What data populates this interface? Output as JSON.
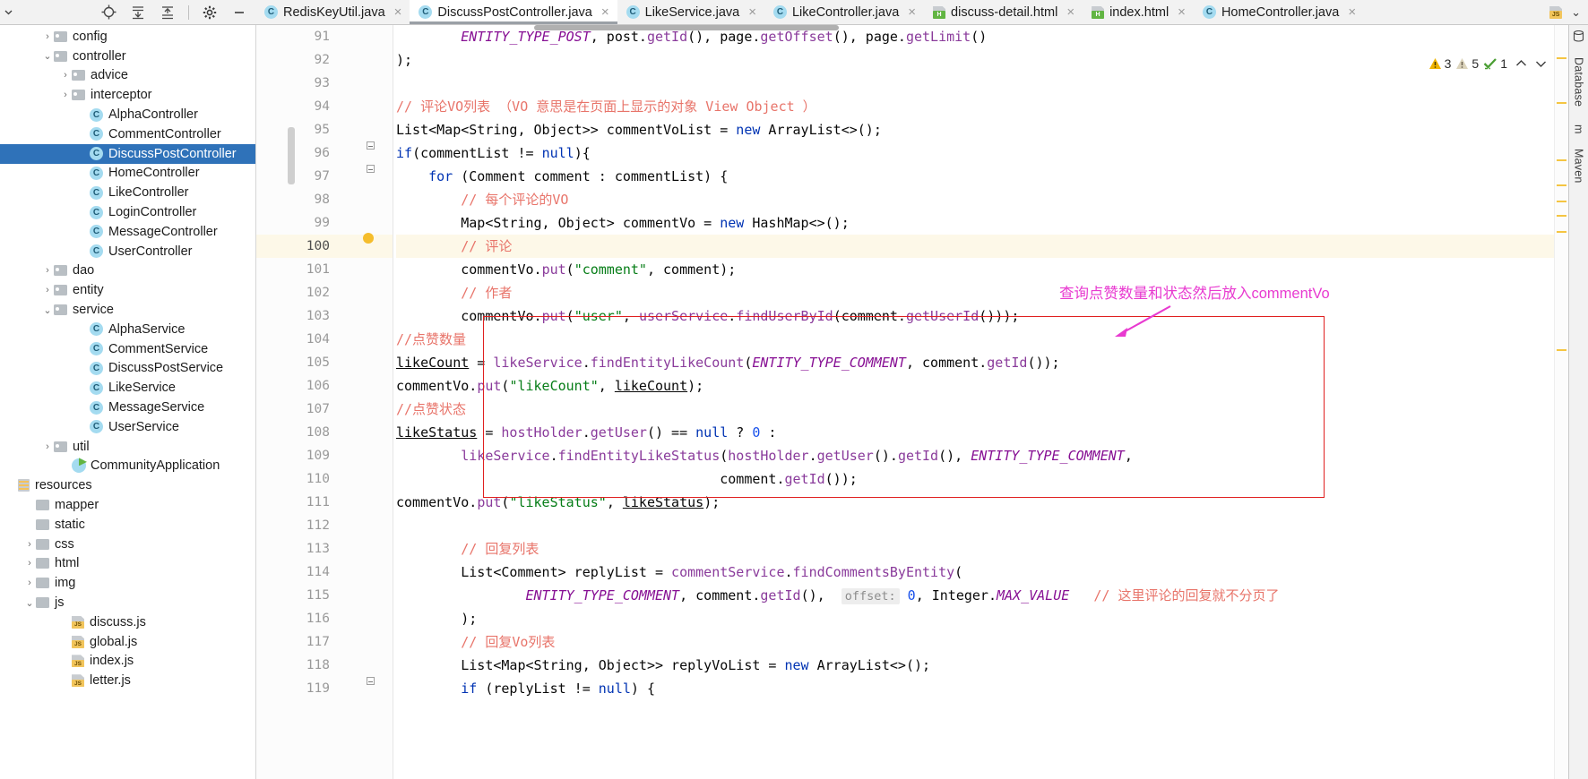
{
  "toolbar": {
    "icons": [
      {
        "name": "locate-icon",
        "glyph": "target"
      },
      {
        "name": "expand-all-icon",
        "glyph": "expand"
      },
      {
        "name": "collapse-all-icon",
        "glyph": "collapse"
      },
      {
        "name": "settings-gear-icon",
        "glyph": "gear"
      },
      {
        "name": "hide-icon",
        "glyph": "minus"
      }
    ]
  },
  "tabs": [
    {
      "label": "RedisKeyUtil.java",
      "type": "java",
      "active": false,
      "close": "×"
    },
    {
      "label": "DiscussPostController.java",
      "type": "java",
      "active": true,
      "close": "×"
    },
    {
      "label": "LikeService.java",
      "type": "java",
      "active": false,
      "close": "×"
    },
    {
      "label": "LikeController.java",
      "type": "java",
      "active": false,
      "close": "×"
    },
    {
      "label": "discuss-detail.html",
      "type": "html",
      "active": false,
      "close": "×"
    },
    {
      "label": "index.html",
      "type": "html",
      "active": false,
      "close": "×"
    },
    {
      "label": "HomeController.java",
      "type": "java",
      "active": false,
      "close": "×"
    }
  ],
  "tabs_overflow": {
    "icon": "js-file-icon",
    "chevron": "⌄"
  },
  "tree": [
    {
      "label": "config",
      "type": "folder",
      "arrow": "›",
      "indent": 2,
      "selected": false
    },
    {
      "label": "controller",
      "type": "folder",
      "arrow": "⌄",
      "indent": 2,
      "selected": false
    },
    {
      "label": "advice",
      "type": "folder",
      "arrow": "›",
      "indent": 3,
      "selected": false
    },
    {
      "label": "interceptor",
      "type": "folder",
      "arrow": "›",
      "indent": 3,
      "selected": false
    },
    {
      "label": "AlphaController",
      "type": "class",
      "arrow": "",
      "indent": 4,
      "selected": false
    },
    {
      "label": "CommentController",
      "type": "class",
      "arrow": "",
      "indent": 4,
      "selected": false
    },
    {
      "label": "DiscussPostController",
      "type": "class",
      "arrow": "",
      "indent": 4,
      "selected": true
    },
    {
      "label": "HomeController",
      "type": "class",
      "arrow": "",
      "indent": 4,
      "selected": false
    },
    {
      "label": "LikeController",
      "type": "class",
      "arrow": "",
      "indent": 4,
      "selected": false
    },
    {
      "label": "LoginController",
      "type": "class",
      "arrow": "",
      "indent": 4,
      "selected": false
    },
    {
      "label": "MessageController",
      "type": "class",
      "arrow": "",
      "indent": 4,
      "selected": false
    },
    {
      "label": "UserController",
      "type": "class",
      "arrow": "",
      "indent": 4,
      "selected": false
    },
    {
      "label": "dao",
      "type": "folder",
      "arrow": "›",
      "indent": 2,
      "selected": false
    },
    {
      "label": "entity",
      "type": "folder",
      "arrow": "›",
      "indent": 2,
      "selected": false
    },
    {
      "label": "service",
      "type": "folder",
      "arrow": "⌄",
      "indent": 2,
      "selected": false
    },
    {
      "label": "AlphaService",
      "type": "class",
      "arrow": "",
      "indent": 4,
      "selected": false
    },
    {
      "label": "CommentService",
      "type": "class",
      "arrow": "",
      "indent": 4,
      "selected": false
    },
    {
      "label": "DiscussPostService",
      "type": "class",
      "arrow": "",
      "indent": 4,
      "selected": false
    },
    {
      "label": "LikeService",
      "type": "class",
      "arrow": "",
      "indent": 4,
      "selected": false
    },
    {
      "label": "MessageService",
      "type": "class",
      "arrow": "",
      "indent": 4,
      "selected": false
    },
    {
      "label": "UserService",
      "type": "class",
      "arrow": "",
      "indent": 4,
      "selected": false
    },
    {
      "label": "util",
      "type": "folder",
      "arrow": "›",
      "indent": 2,
      "selected": false
    },
    {
      "label": "CommunityApplication",
      "type": "spring",
      "arrow": "",
      "indent": 3,
      "selected": false
    },
    {
      "label": "resources",
      "type": "resources",
      "arrow": "",
      "indent": 0,
      "selected": false
    },
    {
      "label": "mapper",
      "type": "folder-plain",
      "arrow": "",
      "indent": 1,
      "selected": false
    },
    {
      "label": "static",
      "type": "folder-plain",
      "arrow": "",
      "indent": 1,
      "selected": false
    },
    {
      "label": "css",
      "type": "folder-plain",
      "arrow": "›",
      "indent": 1,
      "selected": false
    },
    {
      "label": "html",
      "type": "folder-plain",
      "arrow": "›",
      "indent": 1,
      "selected": false
    },
    {
      "label": "img",
      "type": "folder-plain",
      "arrow": "›",
      "indent": 1,
      "selected": false
    },
    {
      "label": "js",
      "type": "folder-plain",
      "arrow": "⌄",
      "indent": 1,
      "selected": false
    },
    {
      "label": "discuss.js",
      "type": "js",
      "arrow": "",
      "indent": 3,
      "selected": false
    },
    {
      "label": "global.js",
      "type": "js",
      "arrow": "",
      "indent": 3,
      "selected": false
    },
    {
      "label": "index.js",
      "type": "js",
      "arrow": "",
      "indent": 3,
      "selected": false
    },
    {
      "label": "letter.js",
      "type": "js",
      "arrow": "",
      "indent": 3,
      "selected": false
    }
  ],
  "editor": {
    "first_line_number": 91,
    "current_line": 100,
    "line_numbers": [
      91,
      92,
      93,
      94,
      95,
      96,
      97,
      98,
      99,
      100,
      101,
      102,
      103,
      104,
      105,
      106,
      107,
      108,
      109,
      110,
      111,
      112,
      113,
      114,
      115,
      116,
      117,
      118,
      119
    ],
    "code_lines": [
      "        ENTITY_TYPE_POST, post.getId(), page.getOffset(), page.getLimit()",
      ");",
      "",
      "// 评论VO列表 （VO 意思是在页面上显示的对象 View Object ）",
      "List<Map<String, Object>> commentVoList = new ArrayList<>();",
      "if(commentList != null){",
      "    for (Comment comment : commentList) {",
      "        // 每个评论的VO",
      "        Map<String, Object> commentVo = new HashMap<>();",
      "        // 评论",
      "        commentVo.put(\"comment\", comment);",
      "        // 作者",
      "        commentVo.put(\"user\", userService.findUserById(comment.getUserId()));",
      "//点赞数量",
      "likeCount = likeService.findEntityLikeCount(ENTITY_TYPE_COMMENT, comment.getId());",
      "commentVo.put(\"likeCount\", likeCount);",
      "//点赞状态",
      "likeStatus = hostHolder.getUser() == null ? 0 :",
      "        likeService.findEntityLikeStatus(hostHolder.getUser().getId(), ENTITY_TYPE_COMMENT,",
      "                                        comment.getId());",
      "commentVo.put(\"likeStatus\", likeStatus);",
      "",
      "        // 回复列表",
      "        List<Comment> replyList = commentService.findCommentsByEntity(",
      "                ENTITY_TYPE_COMMENT, comment.getId(),  offset: 0, Integer.MAX_VALUE   // 这里评论的回复就不分页了",
      "        );",
      "        // 回复Vo列表",
      "        List<Map<String, Object>> replyVoList = new ArrayList<>();",
      "        if (replyList != null) {"
    ],
    "inline_hint": "offset:",
    "annotation": "查询点赞数量和状态然后放入commentVo",
    "highlight_box_color": "#e02020",
    "annotation_color": "#e83ad0"
  },
  "inspections": {
    "warning_count": "3",
    "weak_warning_count": "5",
    "typo_count": "1",
    "up_arrow": "⌃",
    "down_arrow": "⌄"
  },
  "right_strip": {
    "labels": [
      "Database",
      "m",
      "Maven"
    ]
  }
}
